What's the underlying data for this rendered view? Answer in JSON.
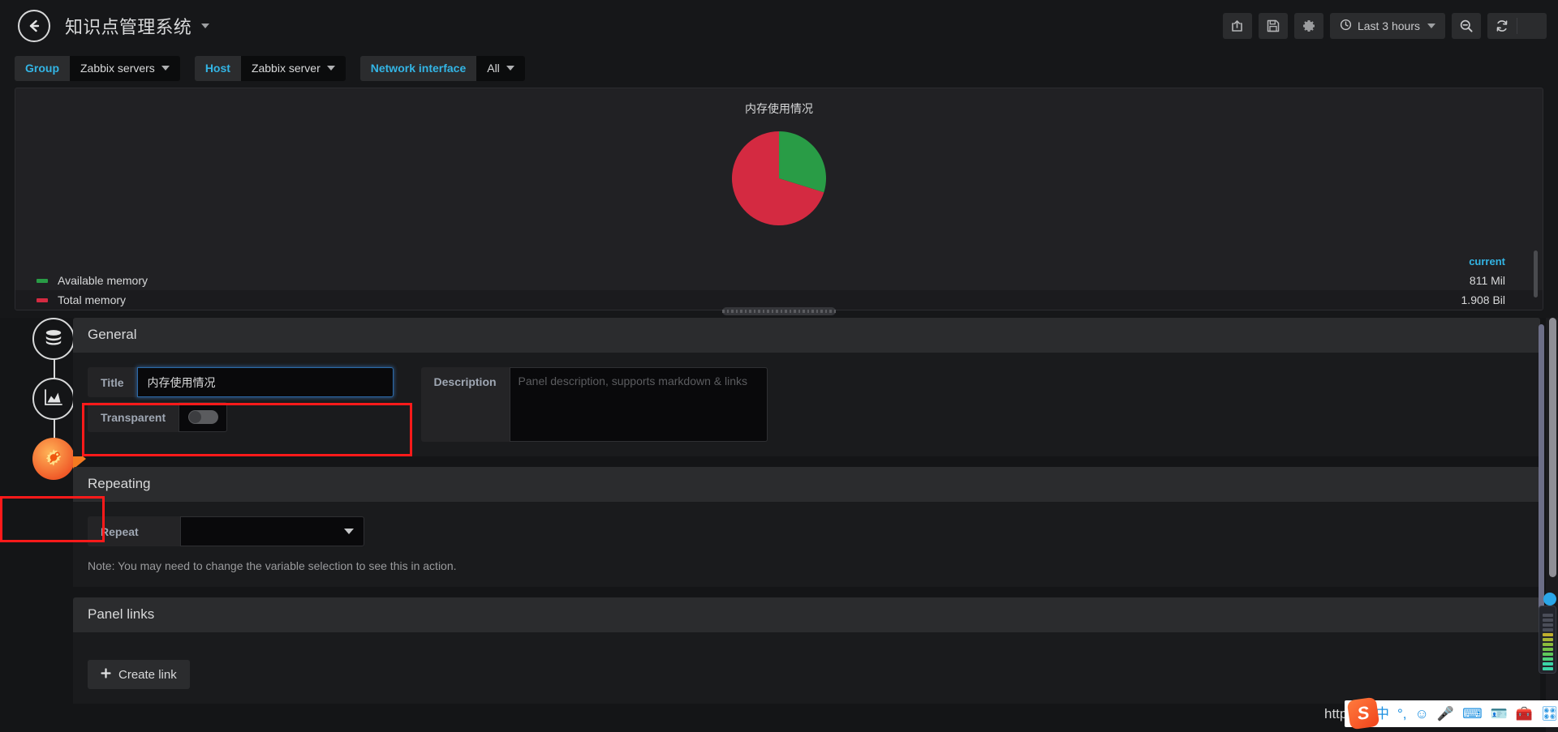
{
  "navbar": {
    "back_icon": "arrow-left-icon",
    "dashboard_title": "知识点管理系统",
    "buttons": [
      {
        "name": "share-dashboard-button",
        "icon": "share-icon",
        "label": ""
      },
      {
        "name": "save-dashboard-button",
        "icon": "save-floppy-icon",
        "label": ""
      },
      {
        "name": "dashboard-settings-button",
        "icon": "gear-icon",
        "label": ""
      }
    ],
    "time_picker": {
      "icon": "clock-icon",
      "label": "Last 3 hours"
    },
    "zoom_out_button": {
      "icon": "zoom-out-magnifier-icon",
      "label": ""
    },
    "refresh_button": {
      "icon": "refresh-icon",
      "label": ""
    },
    "refresh_interval_caret": {
      "icon": "chevron-down-icon",
      "label": ""
    }
  },
  "variables": [
    {
      "label": "Group",
      "value": "Zabbix servers"
    },
    {
      "label": "Host",
      "value": "Zabbix server"
    },
    {
      "label": "Network interface",
      "value": "All"
    }
  ],
  "panel": {
    "title": "内存使用情况",
    "legend_header": "current"
  },
  "chart_data": {
    "type": "pie",
    "title": "内存使用情况",
    "labels": [
      "Available memory",
      "Total memory"
    ],
    "values": [
      811000000,
      1908000000
    ],
    "display_values": [
      "811 Mil",
      "1.908 Bil"
    ],
    "fractions": [
      0.298,
      0.702
    ],
    "colors": [
      "#299c46",
      "#d42a41"
    ],
    "legend": {
      "position": "bottom",
      "columns": [
        "current"
      ]
    },
    "start_angle_deg": 0,
    "grid": false
  },
  "editor": {
    "rail": [
      {
        "name": "queries-tab",
        "icon": "database-icon",
        "active": false
      },
      {
        "name": "visualization-tab",
        "icon": "area-chart-icon",
        "active": false
      },
      {
        "name": "general-settings-tab",
        "icon": "gear-wrench-icon",
        "active": true
      }
    ],
    "general": {
      "header": "General",
      "title_label": "Title",
      "title_value": "内存使用情况",
      "transparent_label": "Transparent",
      "transparent_on": false,
      "description_label": "Description",
      "description_value": "",
      "description_placeholder": "Panel description, supports markdown & links"
    },
    "repeating": {
      "header": "Repeating",
      "repeat_label": "Repeat",
      "repeat_value": "",
      "note": "Note: You may need to change the variable selection to see this in action."
    },
    "panel_links": {
      "header": "Panel links",
      "create_link_label": "Create link",
      "create_link_icon": "plus-icon"
    }
  },
  "overlay": {
    "watermark": "https://blog.csdn.net/weixin_44453638",
    "ime": {
      "logo": "S",
      "icons": [
        "chinese-mode-icon",
        "punctuation-icon",
        "emoji-icon",
        "voice-input-icon",
        "soft-keyboard-icon",
        "user-card-icon",
        "toolbox-icon",
        "skin-icon"
      ]
    }
  },
  "colors": {
    "accent_blue": "#33b5e5",
    "annotation_red": "#ff1a1a",
    "active_orange": "#f47a20",
    "pie_green": "#299c46",
    "pie_red": "#d42a41"
  }
}
